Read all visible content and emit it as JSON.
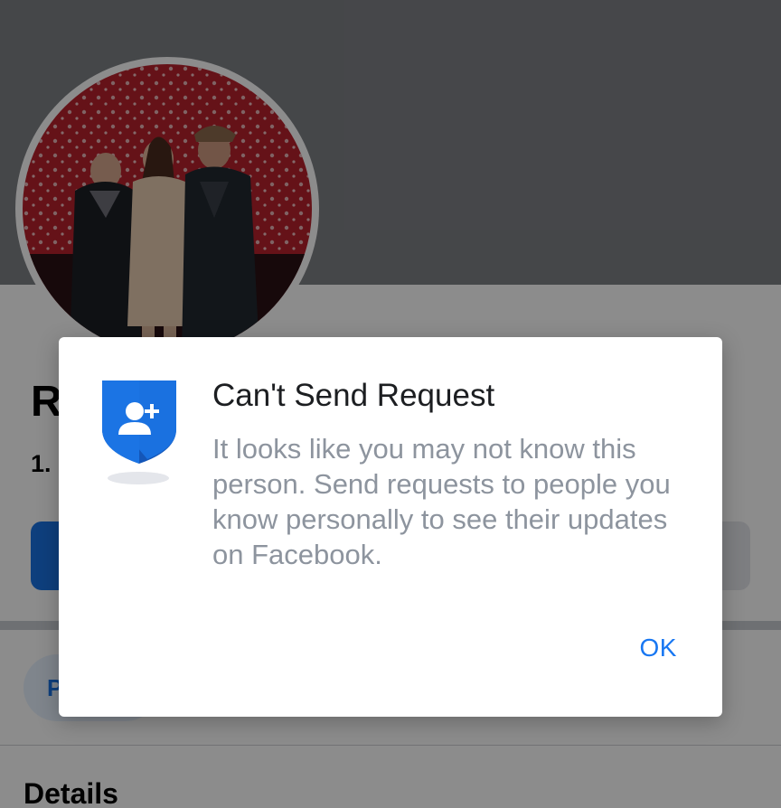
{
  "profile": {
    "name_visible": "R",
    "stats_visible": "1.",
    "primary_button_label": "",
    "secondary_button_label": "",
    "tab_chip_visible": "P",
    "section_heading": "Details"
  },
  "dialog": {
    "title": "Can't Send Request",
    "message": "It looks like you may not know this person. Send requests to people you know personally to see their updates on Facebook.",
    "ok_label": "OK",
    "icon": "add-friend-shield-icon"
  },
  "colors": {
    "brand_blue": "#1877f2",
    "shield_blue": "#1b74e4",
    "shield_dark": "#1456b8",
    "message_gray": "#8d949e"
  }
}
